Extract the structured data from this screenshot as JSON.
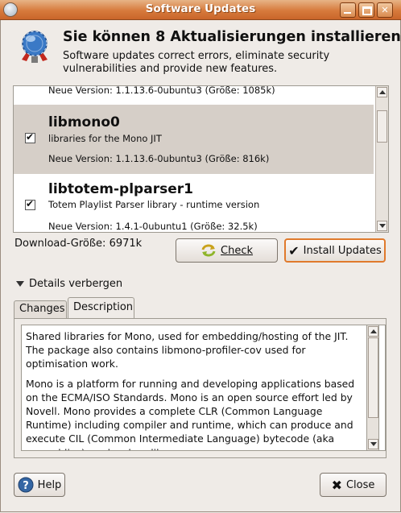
{
  "window": {
    "title": "Software Updates"
  },
  "header": {
    "title": "Sie können 8 Aktualisierungen installieren",
    "subtitle": "Software updates correct errors, eliminate security vulnerabilities and provide new features."
  },
  "packages": [
    {
      "name": "",
      "description": "",
      "version": "Neue Version: 1.1.13.6-0ubuntu3 (Größe: 1085k)",
      "checked": true
    },
    {
      "name": "libmono0",
      "description": "libraries for the Mono JIT",
      "version": "Neue Version: 1.1.13.6-0ubuntu3 (Größe: 816k)",
      "checked": true
    },
    {
      "name": "libtotem-plparser1",
      "description": "Totem Playlist Parser library - runtime version",
      "version": "Neue Version: 1.4.1-0ubuntu1 (Größe: 32.5k)",
      "checked": true
    }
  ],
  "download_size": "Download-Größe: 6971k",
  "buttons": {
    "check": "Check",
    "install": "Install Updates",
    "help": "Help",
    "close": "Close"
  },
  "details": {
    "toggle": "Details verbergen"
  },
  "tabs": [
    {
      "label": "Changes"
    },
    {
      "label": "Description"
    }
  ],
  "description": {
    "p1": "Shared libraries for Mono, used for embedding/hosting of the JIT. The package also contains libmono-profiler-cov used for optimisation work.",
    "p2": "Mono is a platform for running and developing applications based on the ECMA/ISO Standards. Mono is an open source effort led by Novell. Mono provides a complete CLR (Common Language Runtime) including compiler and runtime, which can produce and execute CIL (Common Intermediate Language) bytecode (aka assemblies), and a class library."
  },
  "colors": {
    "title_bar": "#d77a3c",
    "selected_row": "#d6cfc8",
    "default_button_border": "#e07a2c"
  }
}
